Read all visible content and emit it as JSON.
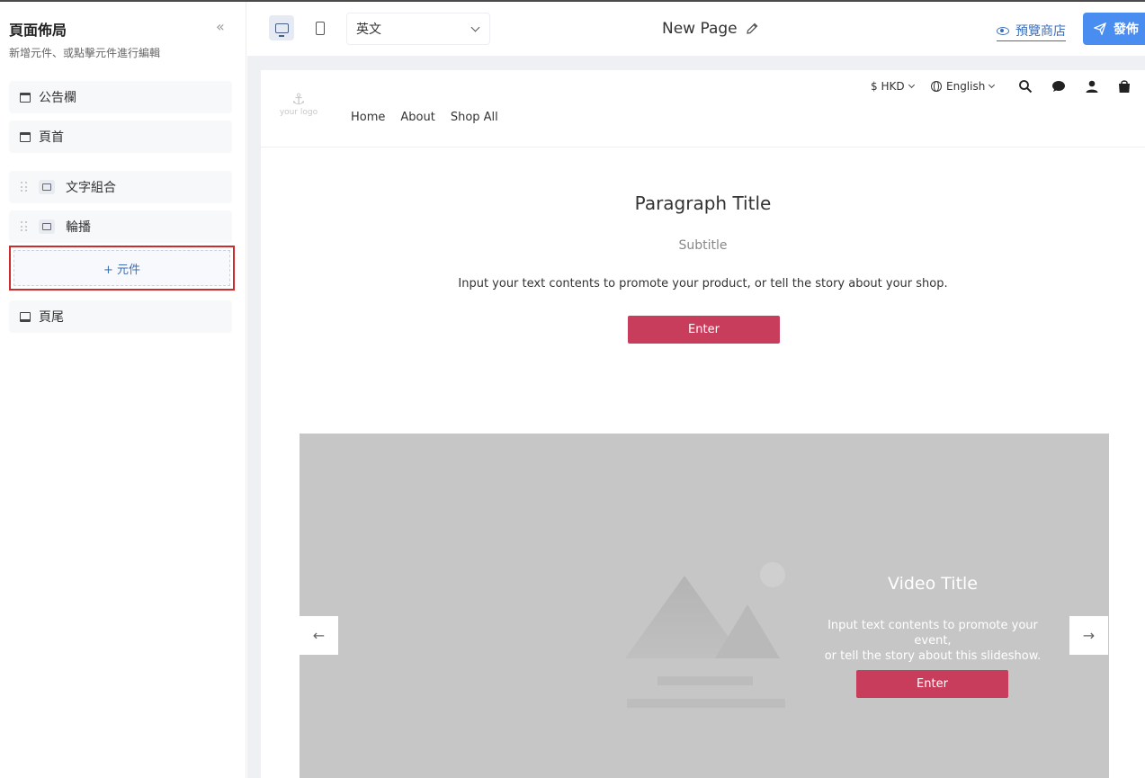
{
  "sidebar": {
    "title": "頁面佈局",
    "subtitle": "新增元件、或點擊元件進行編輯",
    "collapse_glyph": "«",
    "items": {
      "announcement": "公告欄",
      "header": "頁首",
      "text_group": "文字組合",
      "carousel": "輪播",
      "footer": "頁尾"
    },
    "add_component": "+ 元件"
  },
  "toolbar": {
    "language_select": "英文",
    "page_name": "New Page",
    "preview_label": "預覽商店",
    "publish_label": "發佈"
  },
  "store": {
    "logo_text": "your logo",
    "nav": [
      "Home",
      "About",
      "Shop All"
    ],
    "currency": "$ HKD",
    "language": "English",
    "paragraph": {
      "title": "Paragraph Title",
      "subtitle": "Subtitle",
      "body": "Input your text contents to promote your product, or tell the story about your shop.",
      "button": "Enter"
    },
    "slide": {
      "title": "Video Title",
      "body_line1": "Input text contents to promote your event,",
      "body_line2": "or tell the story about this slideshow.",
      "button": "Enter",
      "prev_glyph": "←",
      "next_glyph": "→"
    }
  },
  "colors": {
    "accent": "#4a8df0",
    "link": "#3d6fb8",
    "cta": "#c83c5c",
    "highlight_border": "#cc2c2c"
  }
}
